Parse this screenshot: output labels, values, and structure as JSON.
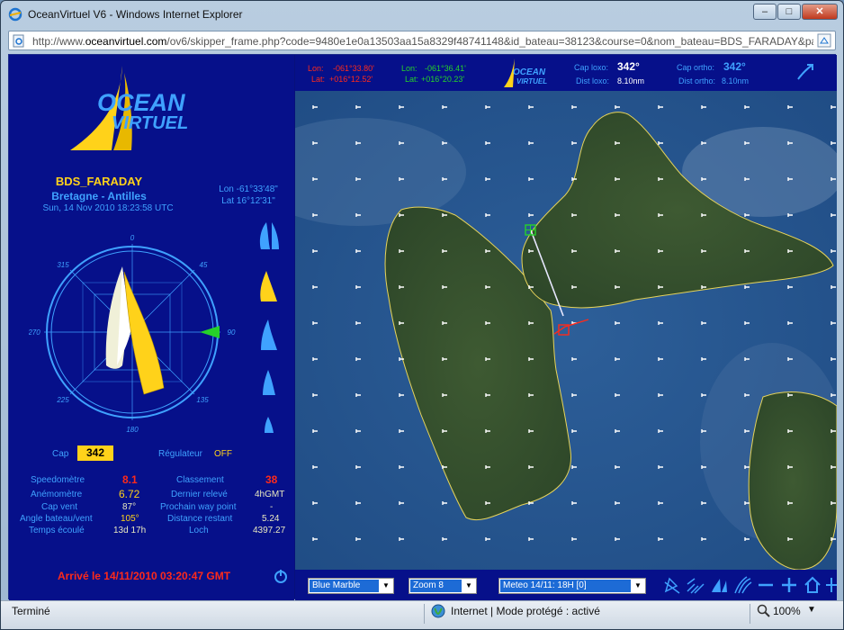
{
  "window": {
    "title": "OceanVirtuel V6 - Windows Internet Explorer",
    "min": "–",
    "max": "□",
    "close": "✕"
  },
  "address": {
    "prefix": "http://www.",
    "host": "oceanvirtuel.com",
    "path": "/ov6/skipper_frame.php?code=9480e1e0a13503aa15a8329f48741148&id_bateau=38123&course=0&nom_bateau=BDS_FARADAY&pas"
  },
  "logo": {
    "line1": "OCEAN",
    "line2": "VIRTUEL",
    "small1": "OCEAN",
    "small2": "VIRTUEL"
  },
  "boat": {
    "name": "BDS_FARADAY",
    "route": "Bretagne - Antilles",
    "datetime": "Sun, 14 Nov 2010 18:23:58 UTC"
  },
  "position": {
    "lon": "Lon -61°33'48\"",
    "lat": "Lat 16°12'31\""
  },
  "compass": {
    "n": "0",
    "ne": "45",
    "e": "90",
    "se": "135",
    "s": "180",
    "sw": "225",
    "w": "270",
    "nw": "315"
  },
  "controls": {
    "cap_label": "Cap",
    "cap_value": "342",
    "reg_label": "Régulateur",
    "reg_value": "OFF"
  },
  "stats_left": [
    {
      "label": "Speedomètre",
      "value": "8.1"
    },
    {
      "label": "Anémomètre",
      "value": "6.72"
    },
    {
      "label": "Cap vent",
      "value": "87°"
    },
    {
      "label": "Angle bateau/vent",
      "value": "105°"
    },
    {
      "label": "Temps écoulé",
      "value": "13d 17h"
    }
  ],
  "stats_right": [
    {
      "label": "Classement",
      "value": "38"
    },
    {
      "label": "Dernier relevé",
      "value": "4hGMT"
    },
    {
      "label": "Prochain way point",
      "value": "-"
    },
    {
      "label": "Distance restant",
      "value": "5.24"
    },
    {
      "label": "Loch",
      "value": "4397.27"
    }
  ],
  "arrived": "Arrivé le 14/11/2010 03:20:47 GMT",
  "top": {
    "lon1_label": "Lon:",
    "lon1_value": "-061°33.80'",
    "lat1_label": "Lat:",
    "lat1_value": "+016°12.52'",
    "lon2_label": "Lon:",
    "lon2_value": "-061°36.41'",
    "lat2_label": "Lat:",
    "lat2_value": "+016°20.23'",
    "cap_loxo_label": "Cap loxo:",
    "cap_loxo_value": "342°",
    "dist_loxo_label": "Dist loxo:",
    "dist_loxo_value": "8.10nm",
    "cap_ortho_label": "Cap ortho:",
    "cap_ortho_value": "342°",
    "dist_ortho_label": "Dist ortho:",
    "dist_ortho_value": "8.10nm"
  },
  "bottom": {
    "layer": "Blue Marble",
    "zoom": "Zoom 8",
    "meteo": "Meteo 14/11: 18H [0]"
  },
  "status": {
    "left": "Terminé",
    "zone": "Internet | Mode protégé : activé",
    "zoom": "100%"
  },
  "colors": {
    "panel": "#06108a",
    "accent_blue": "#3fa2ff",
    "yellow": "#ffd21a",
    "red": "#ff2a1a",
    "green": "#26d12a"
  }
}
